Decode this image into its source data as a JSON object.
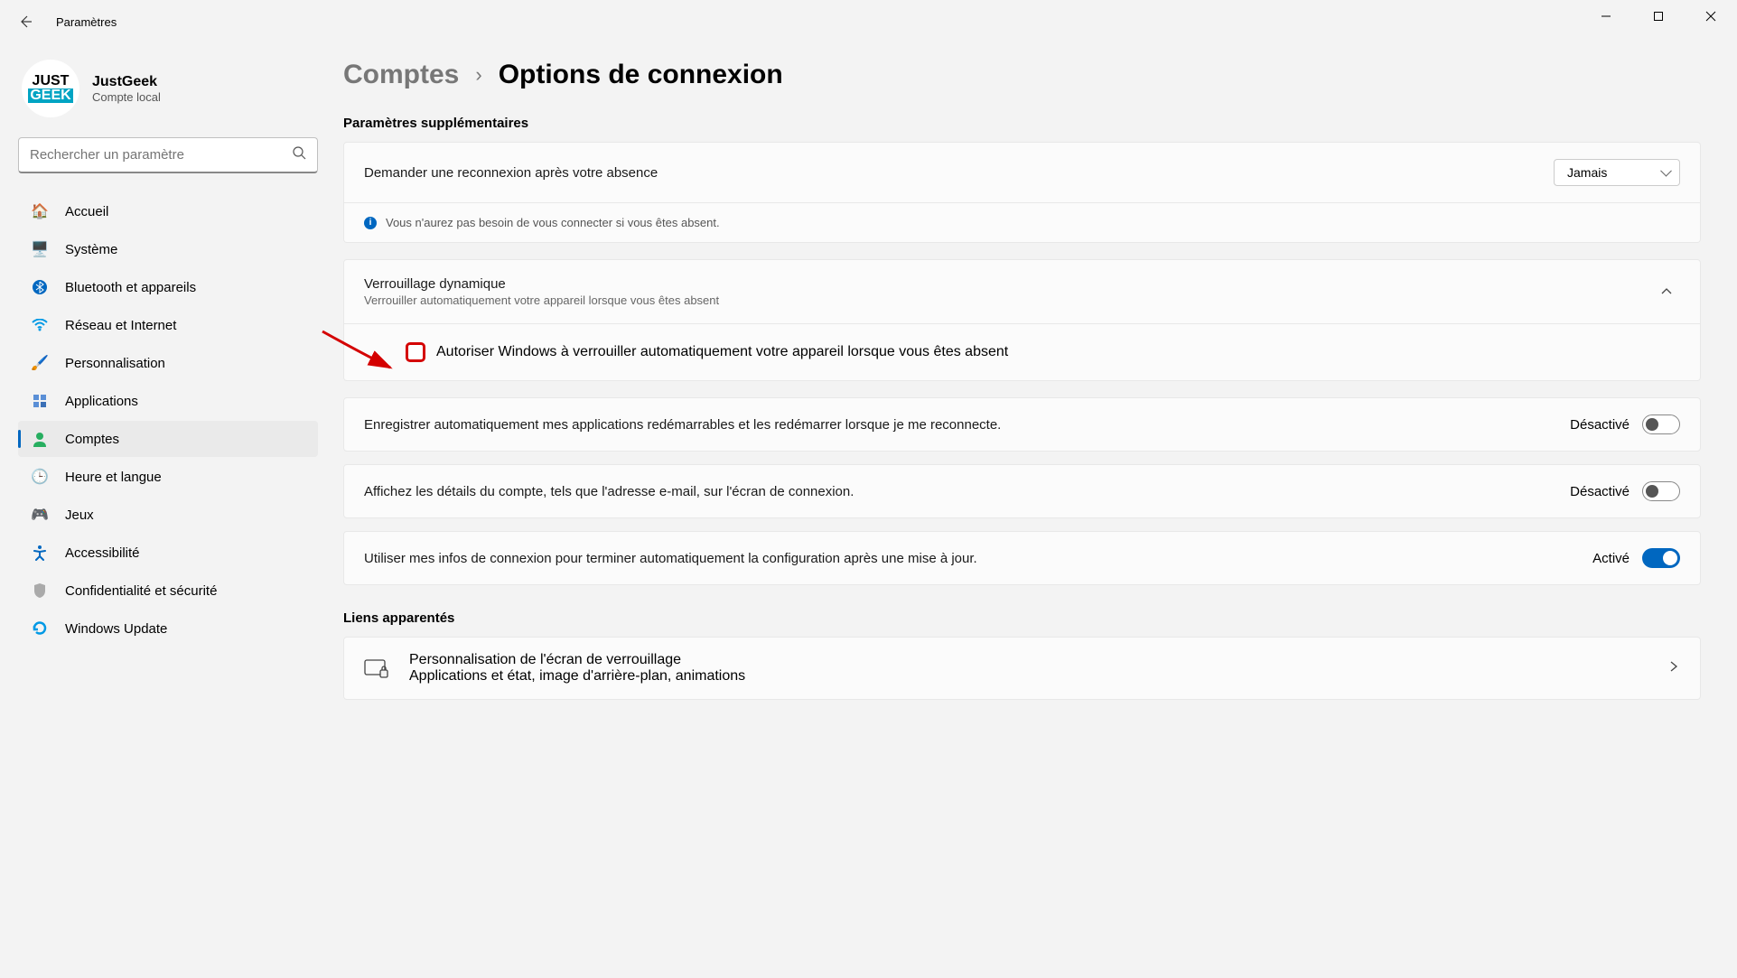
{
  "window": {
    "title": "Paramètres"
  },
  "user": {
    "name": "JustGeek",
    "subtitle": "Compte local",
    "logo_top": "JUST",
    "logo_bot": "GEEK"
  },
  "search": {
    "placeholder": "Rechercher un paramètre"
  },
  "nav": [
    {
      "label": "Accueil",
      "icon": "home"
    },
    {
      "label": "Système",
      "icon": "system"
    },
    {
      "label": "Bluetooth et appareils",
      "icon": "bluetooth"
    },
    {
      "label": "Réseau et Internet",
      "icon": "network"
    },
    {
      "label": "Personnalisation",
      "icon": "personalization"
    },
    {
      "label": "Applications",
      "icon": "apps"
    },
    {
      "label": "Comptes",
      "icon": "accounts",
      "active": true
    },
    {
      "label": "Heure et langue",
      "icon": "time"
    },
    {
      "label": "Jeux",
      "icon": "games"
    },
    {
      "label": "Accessibilité",
      "icon": "accessibility"
    },
    {
      "label": "Confidentialité et sécurité",
      "icon": "privacy"
    },
    {
      "label": "Windows Update",
      "icon": "update"
    }
  ],
  "breadcrumb": {
    "parent": "Comptes",
    "current": "Options de connexion"
  },
  "sections": {
    "additional_title": "Paramètres supplémentaires",
    "reconnect": {
      "label": "Demander une reconnexion après votre absence",
      "value": "Jamais"
    },
    "info_banner": "Vous n'aurez pas besoin de vous connecter si vous êtes absent.",
    "dynlock": {
      "title": "Verrouillage dynamique",
      "subtitle": "Verrouiller automatiquement votre appareil lorsque vous êtes absent",
      "checkbox_label": "Autoriser Windows à verrouiller automatiquement votre appareil lorsque vous êtes absent"
    },
    "restart_apps": {
      "label": "Enregistrer automatiquement mes applications redémarrables et les redémarrer lorsque je me reconnecte.",
      "state": "Désactivé",
      "on": false
    },
    "show_details": {
      "label": "Affichez les détails du compte, tels que l'adresse e-mail, sur l'écran de connexion.",
      "state": "Désactivé",
      "on": false
    },
    "auto_finish": {
      "label": "Utiliser mes infos de connexion pour terminer automatiquement la configuration après une mise à jour.",
      "state": "Activé",
      "on": true
    },
    "related_title": "Liens apparentés",
    "lockscreen": {
      "title": "Personnalisation de l'écran de verrouillage",
      "subtitle": "Applications et état, image d'arrière-plan, animations"
    }
  }
}
